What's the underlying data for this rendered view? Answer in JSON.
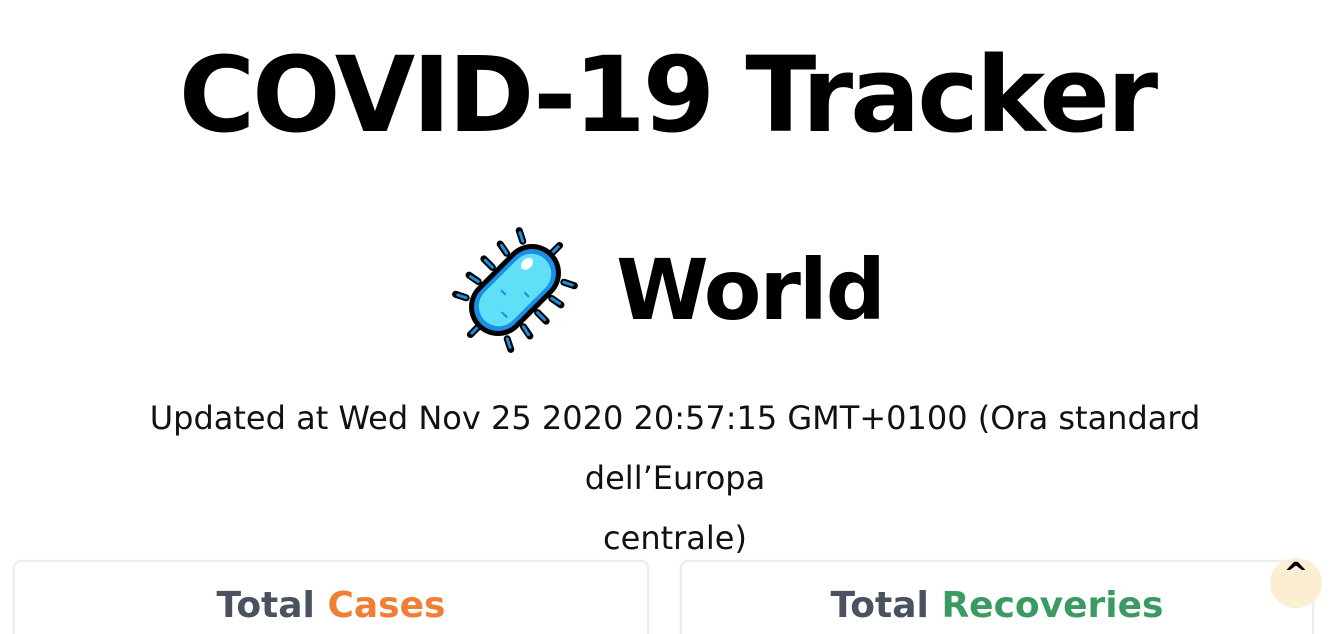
{
  "header": {
    "title": "COVID-19 Tracker"
  },
  "region": {
    "icon": "microbe-icon",
    "name": "World"
  },
  "status": {
    "updated_line1": "Updated at Wed Nov 25 2020 20:57:15 GMT+0100 (Ora standard dell’Europa",
    "updated_line2": "centrale)"
  },
  "cards": {
    "cases": {
      "prefix": "Total",
      "accent": "Cases",
      "accent_color": "#ee7f35"
    },
    "recoveries": {
      "prefix": "Total",
      "accent": "Recoveries",
      "accent_color": "#3a9a62"
    }
  },
  "scroll_top": {
    "icon": "caret-up-icon",
    "label": "^",
    "background": "#fbeed3"
  }
}
